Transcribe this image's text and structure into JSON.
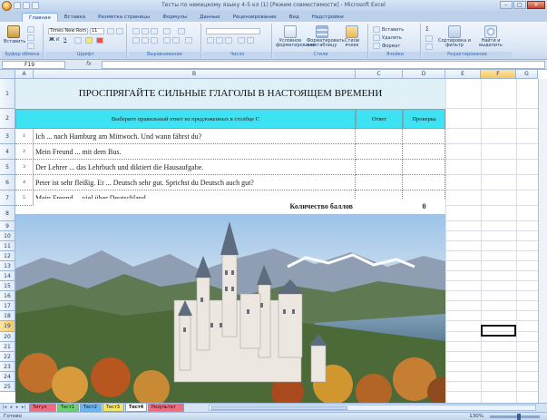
{
  "window": {
    "title": "Тесты по немецкому языку 4-5 кл (1) [Режим совместимости] - Microsoft Excel",
    "controls": [
      "–",
      "□",
      "✕"
    ]
  },
  "ribbon": {
    "tabs": [
      "Главная",
      "Вставка",
      "Разметка страницы",
      "Формулы",
      "Данные",
      "Рецензирование",
      "Вид",
      "Надстройки"
    ],
    "active_tab": "Главная",
    "clipboard": {
      "paste_label": "Вставить",
      "group_label": "Буфер обмена"
    },
    "font": {
      "name": "Times New Rom",
      "size": "11",
      "bold": "Ж",
      "italic": "К",
      "underline": "Ч",
      "group_label": "Шрифт"
    },
    "alignment": {
      "group_label": "Выравнивание"
    },
    "number": {
      "group_label": "Число"
    },
    "styles": {
      "cond_format": "Условное форматирование",
      "format_table": "Форматировать как таблицу",
      "cell_styles": "Стили ячеек",
      "group_label": "Стили"
    },
    "cells": {
      "insert": "Вставить",
      "delete": "Удалить",
      "format": "Формат",
      "group_label": "Ячейки"
    },
    "editing": {
      "sort": "Сортировка и фильтр",
      "find": "Найти и выделить",
      "group_label": "Редактирование"
    }
  },
  "formula_bar": {
    "name_box": "F19",
    "fx": "fx",
    "formula": ""
  },
  "columns": [
    "A",
    "B",
    "C",
    "D",
    "E",
    "F",
    "G"
  ],
  "rows": [
    "1",
    "2",
    "3",
    "4",
    "5",
    "6",
    "7",
    "8",
    "9",
    "10",
    "11",
    "12",
    "13",
    "14",
    "15",
    "16",
    "17",
    "18",
    "19",
    "20",
    "21",
    "22",
    "23",
    "24",
    "25"
  ],
  "sheet": {
    "title": "ПРОСПРЯГАЙТЕ  СИЛЬНЫЕ ГЛАГОЛЫ В НАСТОЯЩЕМ ВРЕМЕНИ",
    "header_instruction": "Выберите правильный ответ из предложенных в столбце С",
    "header_answer": "Ответ",
    "header_check": "Проверка",
    "questions": [
      {
        "num": "1",
        "text": "Ich ... nach Hamburg am Mittwoch. Und wann fährst du?"
      },
      {
        "num": "2",
        "text": "Mein Freund ... mit dem Bus."
      },
      {
        "num": "3",
        "text": "Der Lehrer ... das Lehrbuch und diktiert die Hausaufgabe."
      },
      {
        "num": "4",
        "text": "Peter ist sehr fleißig. Er ... Deutsch sehr gut. Sprichst du Deutsch auch gut?"
      },
      {
        "num": "5",
        "text": "Mein Freund ... viel über Deutschland."
      }
    ],
    "score_label": "Количество баллов",
    "score_value": "0"
  },
  "sheet_tabs": [
    {
      "label": "Титул",
      "color": "#f06b7d"
    },
    {
      "label": "Тест1",
      "color": "#6fcf6f"
    },
    {
      "label": "Тест2",
      "color": "#69b7f0"
    },
    {
      "label": "Тест3",
      "color": "#f4e46a"
    },
    {
      "label": "Тест4",
      "color": "#ffffff"
    },
    {
      "label": "Результат",
      "color": "#f06b7d"
    }
  ],
  "status": {
    "ready": "Готово",
    "zoom": "130%"
  }
}
